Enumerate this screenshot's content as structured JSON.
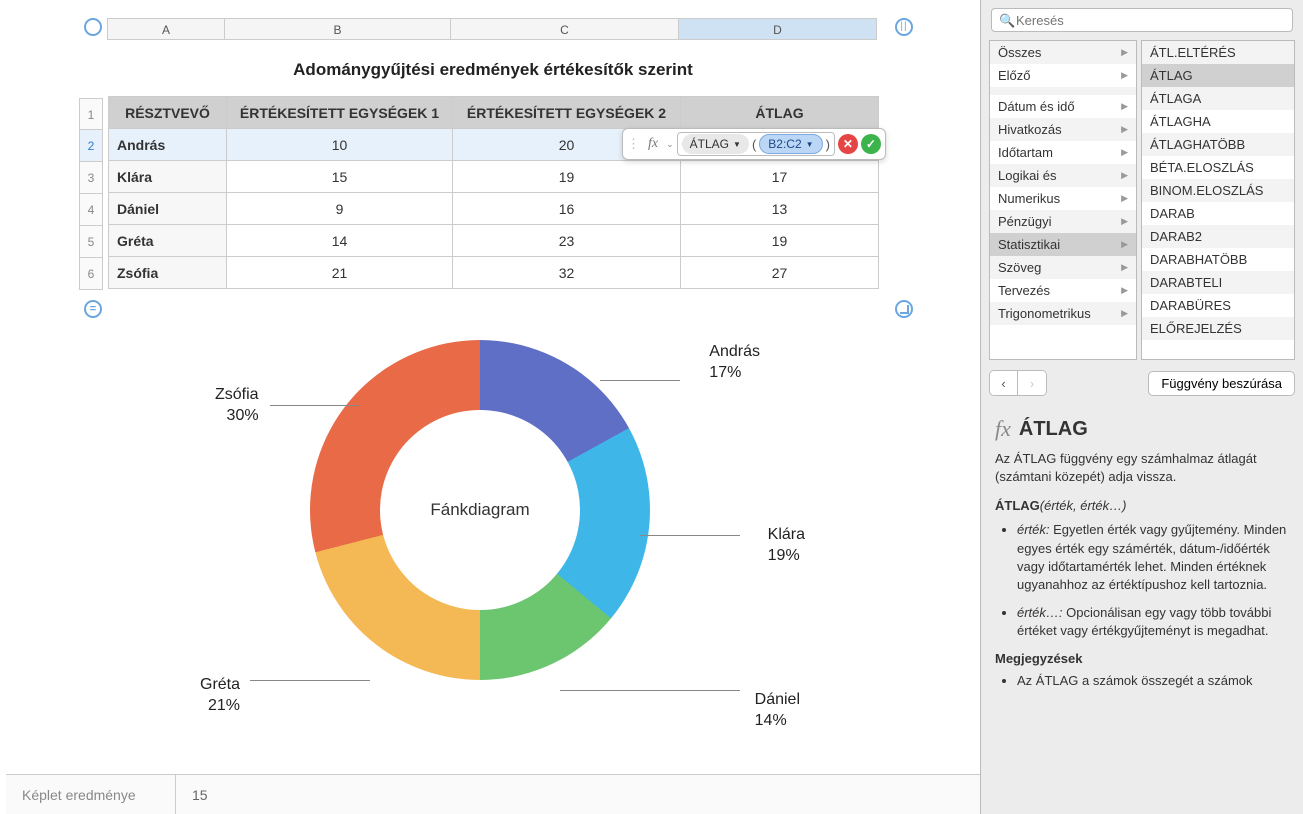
{
  "table": {
    "title": "Adománygyűjtési eredmények értékesítők szerint",
    "columns": [
      "A",
      "B",
      "C",
      "D"
    ],
    "headers": [
      "RÉSZTVEVŐ",
      "ÉRTÉKESÍTETT EGYSÉGEK 1",
      "ÉRTÉKESÍTETT EGYSÉGEK 2",
      "ÁTLAG"
    ],
    "row_numbers": [
      "1",
      "2",
      "3",
      "4",
      "5",
      "6"
    ],
    "rows": [
      {
        "name": "András",
        "u1": "10",
        "u2": "20",
        "avg": ""
      },
      {
        "name": "Klára",
        "u1": "15",
        "u2": "19",
        "avg": "17"
      },
      {
        "name": "Dániel",
        "u1": "9",
        "u2": "16",
        "avg": "13"
      },
      {
        "name": "Gréta",
        "u1": "14",
        "u2": "23",
        "avg": "19"
      },
      {
        "name": "Zsófia",
        "u1": "21",
        "u2": "32",
        "avg": "27"
      }
    ]
  },
  "formula": {
    "fx_label": "fx",
    "fn_token": "ÁTLAG",
    "ref_token": "B2:C2"
  },
  "chart_data": {
    "type": "pie",
    "title": "Fánkdiagram",
    "series": [
      {
        "name": "András",
        "value": 17,
        "color": "#5f6fc5"
      },
      {
        "name": "Klára",
        "value": 19,
        "color": "#3eb7e8"
      },
      {
        "name": "Dániel",
        "value": 14,
        "color": "#6cc56f"
      },
      {
        "name": "Gréta",
        "value": 21,
        "color": "#f4b954"
      },
      {
        "name": "Zsófia",
        "value": 30,
        "color": "#e86a47"
      }
    ],
    "labels_percent": [
      "17%",
      "19%",
      "14%",
      "21%",
      "30%"
    ]
  },
  "status": {
    "label": "Képlet eredménye",
    "value": "15"
  },
  "sidebar": {
    "search_placeholder": "Keresés",
    "categories": [
      "Összes",
      "Előző",
      "",
      "Dátum és idő",
      "Hivatkozás",
      "Időtartam",
      "Logikai és",
      "Numerikus",
      "Pénzügyi",
      "Statisztikai",
      "Szöveg",
      "Tervezés",
      "Trigonometrikus"
    ],
    "selected_category": "Statisztikai",
    "functions": [
      "ÁTL.ELTÉRÉS",
      "ÁTLAG",
      "ÁTLAGA",
      "ÁTLAGHA",
      "ÁTLAGHATÖBB",
      "BÉTA.ELOSZLÁS",
      "BINOM.ELOSZLÁS",
      "DARAB",
      "DARAB2",
      "DARABHATÖBB",
      "DARABTELI",
      "DARABÜRES",
      "ELŐREJELZÉS"
    ],
    "selected_function": "ÁTLAG",
    "insert_button": "Függvény beszúrása",
    "help": {
      "fx": "fx",
      "title": "ÁTLAG",
      "description": "Az ÁTLAG függvény egy számhalmaz átlagát (számtani közepét) adja vissza.",
      "signature_name": "ÁTLAG",
      "signature_args": "(érték, érték…)",
      "arg1_term": "érték:",
      "arg1_text": " Egyetlen érték vagy gyűjtemény. Minden egyes érték egy számérték, dátum-/időérték vagy időtartamérték lehet. Minden értéknek ugyanahhoz az értéktípushoz kell tartoznia.",
      "arg2_term": "érték…:",
      "arg2_text": " Opcionálisan egy vagy több további értéket vagy értékgyűjteményt is megadhat.",
      "notes_heading": "Megjegyzések",
      "note1": "Az ÁTLAG a számok összegét a számok"
    }
  }
}
